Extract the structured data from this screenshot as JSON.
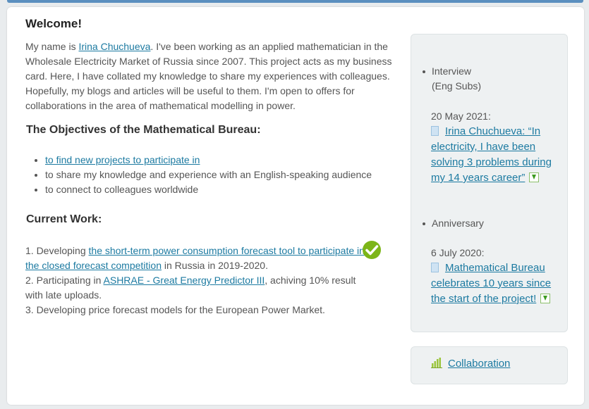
{
  "main": {
    "title": "Welcome!",
    "intro_prefix": "My name is ",
    "intro_link": "Irina Chuchueva",
    "intro_text": ". I've been working as an applied mathematician in the Wholesale Electricity Market of Russia since 2007. This project acts as my business card. Here, I have collated my knowledge to share my experiences with colleagues. Hopefully, my blogs and articles will be useful to them. I'm open to offers for collaborations in the area of mathematical modelling in power.",
    "objectives_heading": "The Objectives of the Mathematical Bureau:",
    "objectives": [
      "to find new projects to participate in",
      "to share my knowledge and experience with an English-speaking audience",
      "to connect to colleagues worldwide"
    ],
    "current_work_heading": "Current Work:",
    "work1_prefix": "1. Developing ",
    "work1_link": "the short-term power consumption forecast tool to participate in the closed forecast competition",
    "work1_suffix": " in Russia in 2019-2020.",
    "work2_prefix": "2. Participating in ",
    "work2_link": "ASHRAE - Great Energy Predictor III",
    "work2_suffix": ", achiving 10% result with late uploads.",
    "work3": "3. Developing price forecast models for the European Power Market."
  },
  "sidebar": {
    "item1_line1": "Interview",
    "item1_line2": "(Eng Subs)",
    "news1_date": "20 May 2021:",
    "news1_title": "Irina Chuchueva: “In electricity, I have been solving 3 problems during my 14 years career”",
    "item2": "Anniversary",
    "news2_date": "6 July 2020:",
    "news2_title": "Mathematical Bureau celebrates 10 years since the start of the project!",
    "collaboration": "Collaboration"
  },
  "icons": {
    "check": "check-circle-icon",
    "document": "document-icon",
    "download": "download-arrow-icon",
    "chart": "bar-chart-icon"
  },
  "colors": {
    "link": "#1c7aa1",
    "check": "#7cb518",
    "sidebar_bg": "#eef1f2"
  }
}
